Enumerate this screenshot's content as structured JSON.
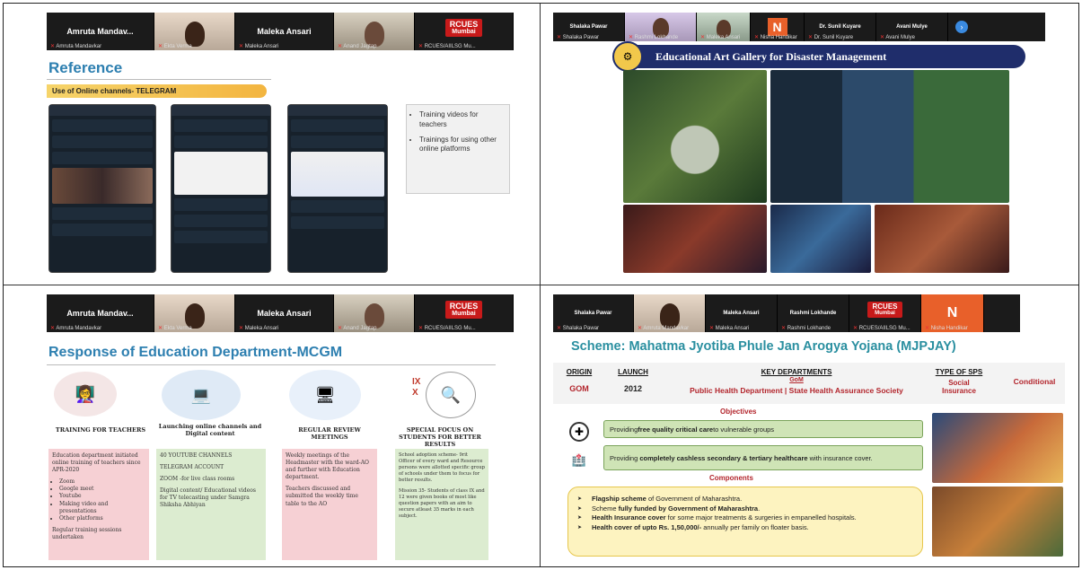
{
  "q1": {
    "zoom_names": [
      "Amruta Mandav...",
      "Maleka Ansari"
    ],
    "zoom_labels": [
      "Amruta Mandavkar",
      "Ekta Verma",
      "Maleka Ansari",
      "Anand Jagtap",
      "RCUES Mumbai",
      "RCUES/AIILSG Mu..."
    ],
    "rcues_line1": "RCUES",
    "rcues_line2": "Mumbai",
    "title": "Reference",
    "pill": "Use of Online channels- TELEGRAM",
    "bullets": [
      "Training videos for teachers",
      "Trainings for using other online platforms"
    ]
  },
  "q2": {
    "zoom_names": [
      "Shalaka Pawar",
      "Dr. Sunil Kuyare",
      "Avani Mulye"
    ],
    "zoom_labels": [
      "Shalaka Pawar",
      "Rashmi Lokhande",
      "Maleka Ansari",
      "Nisha Handikar",
      "Dr. Sunil Kuyare",
      "Avani Mulye"
    ],
    "n_letter": "N",
    "banner": "Educational Art Gallery for Disaster Management"
  },
  "q3": {
    "zoom_names": [
      "Amruta Mandav...",
      "Maleka Ansari"
    ],
    "zoom_labels": [
      "Amruta Mandavkar",
      "Ekta Verma",
      "Maleka Ansari",
      "Anand Jagtap",
      "RCUES/AIILSG Mu..."
    ],
    "rcues_line1": "RCUES",
    "rcues_line2": "Mumbai",
    "title": "Response of Education Department-MCGM",
    "roman": "IX\nX",
    "columns": [
      {
        "head": "TRAINING FOR TEACHERS",
        "intro": "Education department initiated online training of teachers since APR-2020",
        "items": [
          "Zoom",
          "Google meet",
          "Youtube",
          "Making video and presentations",
          "Other platforms"
        ],
        "outro": "Regular training sessions undertaken"
      },
      {
        "head": "Launching online channels and Digital content",
        "paras": [
          "40 YOUTUBE CHANNELS",
          "TELEGRAM ACCOUNT",
          "ZOOM -for live class rooms",
          "Digital content/ Educational videos for TV telecasting under Samgra Shiksha Abhiyan"
        ]
      },
      {
        "head": "REGULAR REVIEW MEETINGS",
        "paras": [
          "Weekly meetings of the Headmaster with the ward-AO and further with Education department.",
          "Teachers discussed and submitted the weekly time table to the AO"
        ]
      },
      {
        "head": "SPECIAL FOCUS ON STUDENTS FOR BETTER RESULTS",
        "paras": [
          "School adoption scheme- 9rit Officer of every ward and Resource persons were allotted specific group of schools under them to focus for better results.",
          "Mission 35- Students of class IX and 12 were given books of most like question papers with an aim to secure atleast 35 marks in each subject."
        ]
      }
    ]
  },
  "q4": {
    "zoom_names": [
      "Shalaka Pawar",
      "Maleka Ansari",
      "Rashmi Lokhande"
    ],
    "zoom_labels": [
      "Shalaka Pawar",
      "Amruta Mandavkar",
      "Maleka Ansari",
      "Rashmi Lokhande",
      "RCUES/AIILSG Mu...",
      "Nisha Handikar"
    ],
    "rcues_line1": "RCUES",
    "rcues_line2": "Mumbai",
    "n_letter": "N",
    "title": "Scheme: Mahatma Jyotiba Phule Jan Arogya Yojana (MJPJAY)",
    "table_heads": [
      "ORIGIN",
      "LAUNCH",
      "KEY DEPARTMENTS",
      "TYPE OF SPS"
    ],
    "table_vals": [
      "GOM",
      "2012",
      "GoM",
      "Public Health Department | State Health Assurance Society",
      "Social Insurance",
      "Conditional"
    ],
    "objectives_title": "Objectives",
    "objectives": [
      {
        "pre": "Providing ",
        "bold": "free quality critical care",
        "post": " to vulnerable groups"
      },
      {
        "pre": "Providing ",
        "bold": "completely cashless secondary & tertiary healthcare",
        "post": " with insurance cover."
      }
    ],
    "components_title": "Components",
    "components": [
      {
        "bold": "Flagship scheme",
        "post": " of Government of Maharashtra."
      },
      {
        "pre": "Scheme ",
        "bold": "fully funded by Government of Maharashtra",
        "post": "."
      },
      {
        "bold": "Health Insurance cover",
        "post": " for some major treatments & surgeries in empanelled hospitals."
      },
      {
        "bold": "Health cover of upto Rs. 1,50,000/-",
        "post": " annually per family on floater basis."
      }
    ]
  },
  "colors": {
    "zoom_bg": "#1b1b1b",
    "title_blue": "#2d7fb0",
    "banner_navy": "#1f2d6b",
    "red": "#b3262d",
    "green_box": "#cfe4b6",
    "yellow_box": "#fdf3c0"
  }
}
